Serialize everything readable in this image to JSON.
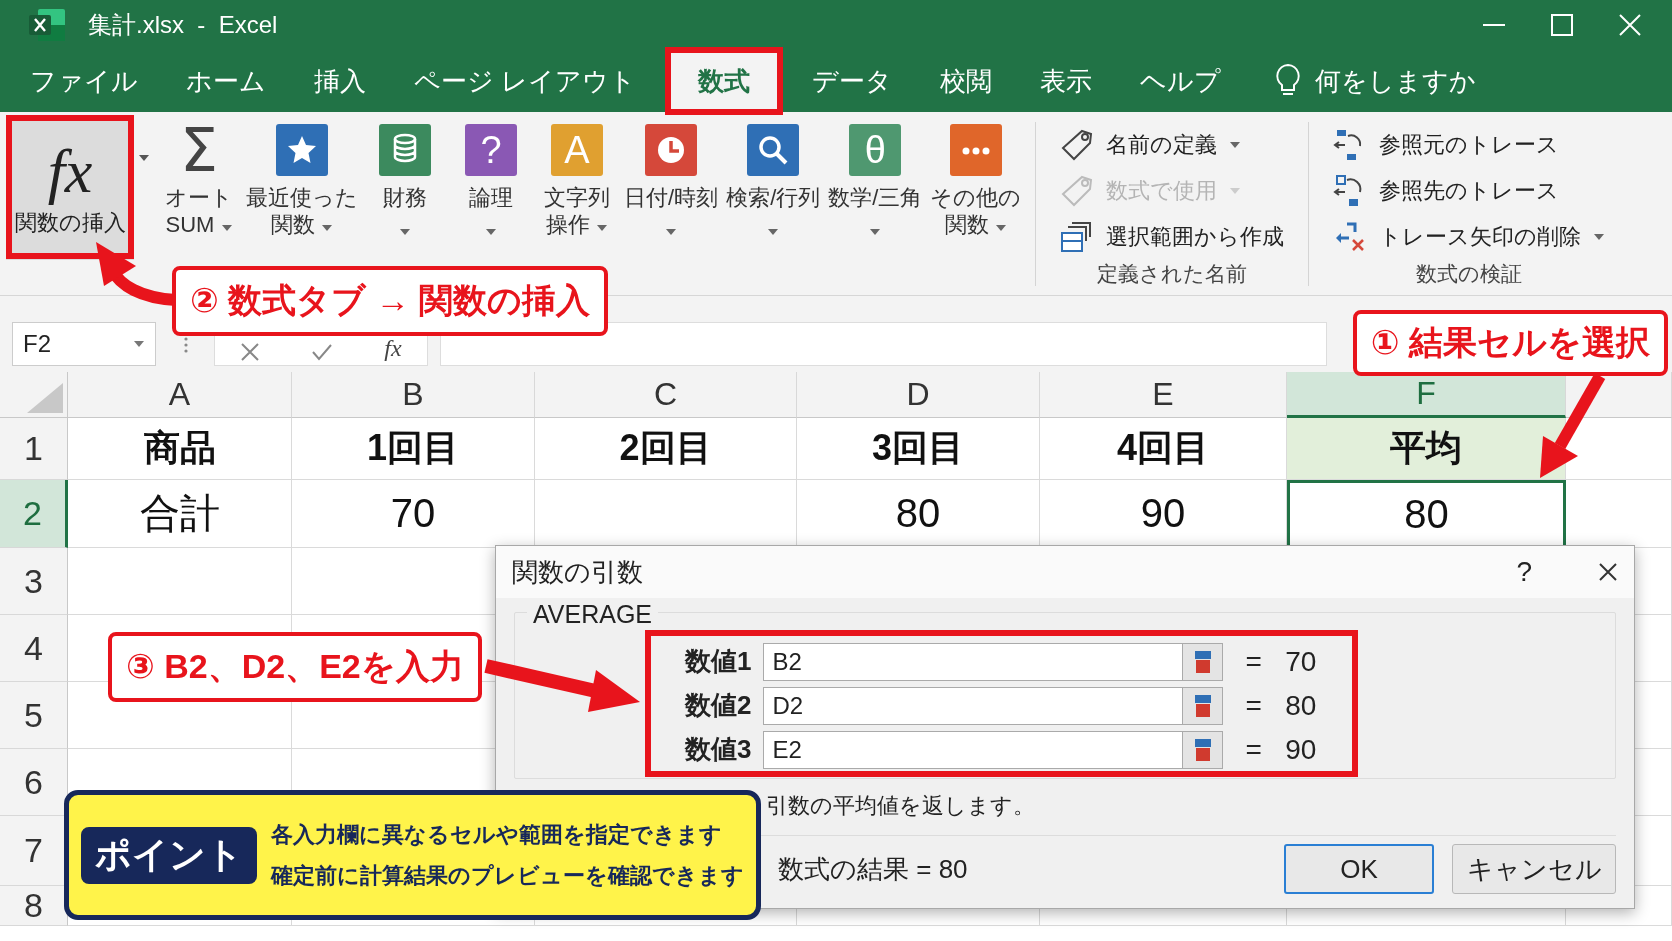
{
  "window": {
    "title": "集計.xlsx  -  Excel"
  },
  "menu_tabs": [
    {
      "label": "ファイル",
      "selected": false
    },
    {
      "label": "ホーム",
      "selected": false
    },
    {
      "label": "挿入",
      "selected": false
    },
    {
      "label": "ページ レイアウト",
      "selected": false
    },
    {
      "label": "数式",
      "selected": true
    },
    {
      "label": "データ",
      "selected": false
    },
    {
      "label": "校閲",
      "selected": false
    },
    {
      "label": "表示",
      "selected": false
    },
    {
      "label": "ヘルプ",
      "selected": false
    }
  ],
  "tell_me": "何をしますか",
  "ribbon": {
    "insert_function": {
      "symbol": "fx",
      "label": "関数の挿入"
    },
    "function_buttons": [
      {
        "kind": "sum",
        "glyph": "Σ",
        "lines": [
          "オート",
          "SUM"
        ]
      },
      {
        "kind": "star",
        "color": "#2f6fb5",
        "lines": [
          "最近使った",
          "関数"
        ]
      },
      {
        "kind": "coins",
        "color": "#3c8a5e",
        "lines": [
          "財務"
        ]
      },
      {
        "kind": "glyph",
        "glyph": "?",
        "color": "#8a58b4",
        "lines": [
          "論理"
        ]
      },
      {
        "kind": "glyph",
        "glyph": "A",
        "color": "#e0a030",
        "lines": [
          "文字列",
          "操作"
        ]
      },
      {
        "kind": "clock",
        "color": "#d5483a",
        "lines": [
          "日付/時刻"
        ]
      },
      {
        "kind": "search",
        "color": "#2f6fb5",
        "lines": [
          "検索/行列"
        ]
      },
      {
        "kind": "glyph",
        "glyph": "θ",
        "color": "#4f9870",
        "lines": [
          "数学/三角"
        ]
      },
      {
        "kind": "more",
        "color": "#e0662a",
        "lines": [
          "その他の",
          "関数"
        ]
      }
    ],
    "names_group": {
      "label": "定義された名前",
      "items": [
        {
          "kind": "tag",
          "label": "名前の定義",
          "disabled": false,
          "dropdown": true
        },
        {
          "kind": "tag",
          "label": "数式で使用",
          "disabled": true,
          "dropdown": true
        },
        {
          "kind": "table",
          "label": "選択範囲から作成",
          "disabled": false,
          "dropdown": false
        }
      ]
    },
    "audit_group": {
      "label": "数式の検証",
      "items": [
        {
          "kind": "precedents",
          "label": "参照元のトレース",
          "dropdown": false
        },
        {
          "kind": "dependents",
          "label": "参照先のトレース",
          "dropdown": false
        },
        {
          "kind": "remove",
          "label": "トレース矢印の削除",
          "dropdown": true
        }
      ]
    }
  },
  "formula_bar": {
    "name_box": "F2",
    "function_symbol": "fx"
  },
  "sheet": {
    "columns": [
      {
        "label": "A",
        "selected": false
      },
      {
        "label": "B",
        "selected": false
      },
      {
        "label": "C",
        "selected": false
      },
      {
        "label": "D",
        "selected": false
      },
      {
        "label": "E",
        "selected": false
      },
      {
        "label": "F",
        "selected": true
      }
    ],
    "rows": [
      {
        "header": "1",
        "kind": "heading",
        "selected": false,
        "cells": {
          "A": "商品",
          "B": "1回目",
          "C": "2回目",
          "D": "3回目",
          "E": "4回目",
          "F": "平均"
        }
      },
      {
        "header": "2",
        "kind": "data",
        "selected": true,
        "cells": {
          "A": "合計",
          "B": "70",
          "D": "80",
          "E": "90",
          "F": "80"
        }
      },
      {
        "header": "3",
        "kind": "data",
        "selected": false
      },
      {
        "header": "4",
        "kind": "data",
        "selected": false
      },
      {
        "header": "5",
        "kind": "data",
        "selected": false
      },
      {
        "header": "6",
        "kind": "data",
        "selected": false
      },
      {
        "header": "7",
        "kind": "data",
        "selected": false
      },
      {
        "header": "8",
        "kind": "data",
        "selected": false
      }
    ]
  },
  "dialog": {
    "title": "関数の引数",
    "help": "?",
    "function_name": "AVERAGE",
    "arguments": [
      {
        "label": "数値1",
        "value": "B2",
        "equals": "=",
        "result": "70"
      },
      {
        "label": "数値2",
        "value": "D2",
        "equals": "=",
        "result": "80"
      },
      {
        "label": "数値3",
        "value": "E2",
        "equals": "=",
        "result": "90"
      }
    ],
    "description": "引数の平均値を返します。",
    "formula_result": "数式の結果 = 80",
    "buttons": [
      {
        "label": "OK",
        "default": true
      },
      {
        "label": "キャンセル",
        "default": false
      }
    ]
  },
  "callouts": [
    {
      "text": "② 数式タブ → 関数の挿入"
    },
    {
      "text": "① 結果セルを選択"
    },
    {
      "text": "③ B2、D2、E2を入力"
    }
  ],
  "point": {
    "badge": "ポイント",
    "lines": [
      "各入力欄に異なるセルや範囲を指定できます",
      "確定前に計算結果のプレビューを確認できます"
    ]
  }
}
